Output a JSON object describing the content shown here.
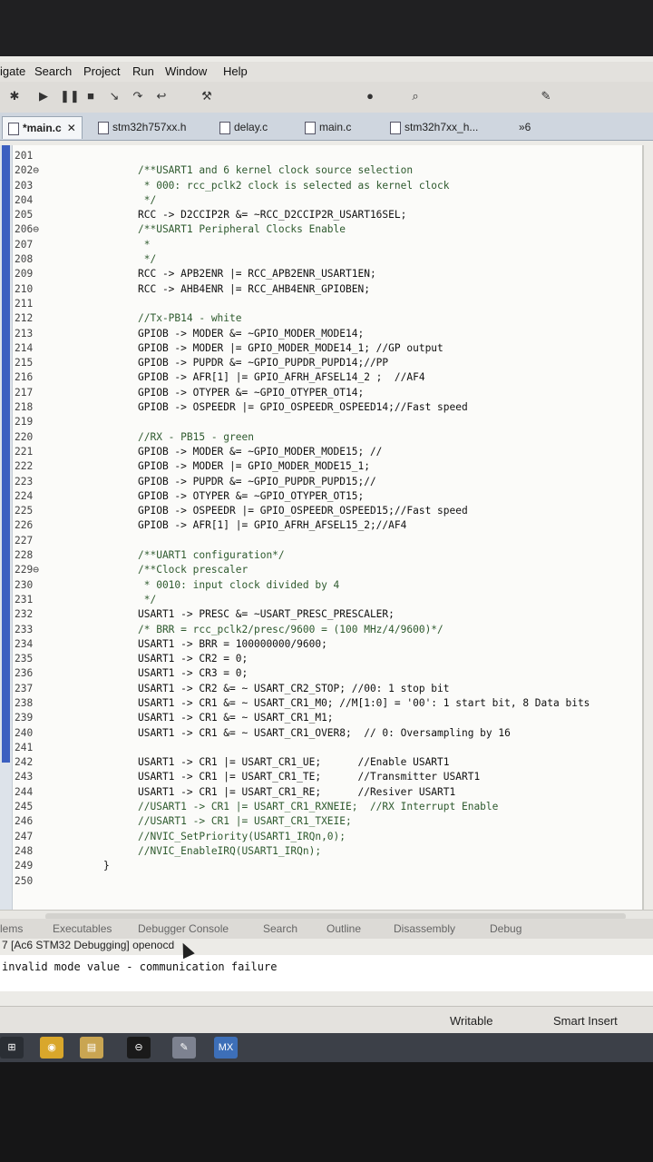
{
  "menu": [
    "igate",
    "Search",
    "Project",
    "Run",
    "Window",
    "Help"
  ],
  "toolbar_icons": [
    "debug-icon",
    "resume-icon",
    "suspend-icon",
    "terminate-icon",
    "step-into-icon",
    "step-over-icon",
    "step-return-icon",
    "build-icon",
    "run-icon",
    "search-icon",
    "pin-icon"
  ],
  "tabs": [
    {
      "label": "*main.c",
      "active": true
    },
    {
      "label": "stm32h757xx.h",
      "active": false
    },
    {
      "label": "delay.c",
      "active": false
    },
    {
      "label": "main.c",
      "active": false
    },
    {
      "label": "stm32h7xx_h...",
      "active": false
    },
    {
      "label": "»6",
      "active": false
    }
  ],
  "code_lines": [
    {
      "n": "201",
      "t": ""
    },
    {
      "n": "202⊖",
      "t": "/**USART1 and 6 kernel clock source selection"
    },
    {
      "n": "203",
      "t": " * 000: rcc_pclk2 clock is selected as kernel clock"
    },
    {
      "n": "204",
      "t": " */"
    },
    {
      "n": "205",
      "t": "RCC -> D2CCIP2R &= ~RCC_D2CCIP2R_USART16SEL;"
    },
    {
      "n": "206⊖",
      "t": "/**USART1 Peripheral Clocks Enable"
    },
    {
      "n": "207",
      "t": " *"
    },
    {
      "n": "208",
      "t": " */"
    },
    {
      "n": "209",
      "t": "RCC -> APB2ENR |= RCC_APB2ENR_USART1EN;"
    },
    {
      "n": "210",
      "t": "RCC -> AHB4ENR |= RCC_AHB4ENR_GPIOBEN;"
    },
    {
      "n": "211",
      "t": ""
    },
    {
      "n": "212",
      "t": "//Tx-PB14 - white"
    },
    {
      "n": "213",
      "t": "GPIOB -> MODER &= ~GPIO_MODER_MODE14;"
    },
    {
      "n": "214",
      "t": "GPIOB -> MODER |= GPIO_MODER_MODE14_1; //GP output"
    },
    {
      "n": "215",
      "t": "GPIOB -> PUPDR &= ~GPIO_PUPDR_PUPD14;//PP"
    },
    {
      "n": "216",
      "t": "GPIOB -> AFR[1] |= GPIO_AFRH_AFSEL14_2 ;  //AF4"
    },
    {
      "n": "217",
      "t": "GPIOB -> OTYPER &= ~GPIO_OTYPER_OT14;"
    },
    {
      "n": "218",
      "t": "GPIOB -> OSPEEDR |= GPIO_OSPEEDR_OSPEED14;//Fast speed"
    },
    {
      "n": "219",
      "t": ""
    },
    {
      "n": "220",
      "t": "//RX - PB15 - green"
    },
    {
      "n": "221",
      "t": "GPIOB -> MODER &= ~GPIO_MODER_MODE15; //"
    },
    {
      "n": "222",
      "t": "GPIOB -> MODER |= GPIO_MODER_MODE15_1;"
    },
    {
      "n": "223",
      "t": "GPIOB -> PUPDR &= ~GPIO_PUPDR_PUPD15;//"
    },
    {
      "n": "224",
      "t": "GPIOB -> OTYPER &= ~GPIO_OTYPER_OT15;"
    },
    {
      "n": "225",
      "t": "GPIOB -> OSPEEDR |= GPIO_OSPEEDR_OSPEED15;//Fast speed"
    },
    {
      "n": "226",
      "t": "GPIOB -> AFR[1] |= GPIO_AFRH_AFSEL15_2;//AF4"
    },
    {
      "n": "227",
      "t": ""
    },
    {
      "n": "228",
      "t": "/**UART1 configuration*/"
    },
    {
      "n": "229⊖",
      "t": "/**Clock prescaler"
    },
    {
      "n": "230",
      "t": " * 0010: input clock divided by 4"
    },
    {
      "n": "231",
      "t": " */"
    },
    {
      "n": "232",
      "t": "USART1 -> PRESC &= ~USART_PRESC_PRESCALER;"
    },
    {
      "n": "233",
      "t": "/* BRR = rcc_pclk2/presc/9600 = (100 MHz/4/9600)*/"
    },
    {
      "n": "234",
      "t": "USART1 -> BRR = 100000000/9600;"
    },
    {
      "n": "235",
      "t": "USART1 -> CR2 = 0;"
    },
    {
      "n": "236",
      "t": "USART1 -> CR3 = 0;"
    },
    {
      "n": "237",
      "t": "USART1 -> CR2 &= ~ USART_CR2_STOP; //00: 1 stop bit"
    },
    {
      "n": "238",
      "t": "USART1 -> CR1 &= ~ USART_CR1_M0; //M[1:0] = '00': 1 start bit, 8 Data bits"
    },
    {
      "n": "239",
      "t": "USART1 -> CR1 &= ~ USART_CR1_M1;"
    },
    {
      "n": "240",
      "t": "USART1 -> CR1 &= ~ USART_CR1_OVER8;  // 0: Oversampling by 16"
    },
    {
      "n": "241",
      "t": ""
    },
    {
      "n": "242",
      "t": "USART1 -> CR1 |= USART_CR1_UE;      //Enable USART1"
    },
    {
      "n": "243",
      "t": "USART1 -> CR1 |= USART_CR1_TE;      //Transmitter USART1"
    },
    {
      "n": "244",
      "t": "USART1 -> CR1 |= USART_CR1_RE;      //Resiver USART1"
    },
    {
      "n": "245",
      "t": "//USART1 -> CR1 |= USART_CR1_RXNEIE;  //RX Interrupt Enable"
    },
    {
      "n": "246",
      "t": "//USART1 -> CR1 |= USART_CR1_TXEIE;"
    },
    {
      "n": "247",
      "t": "//NVIC_SetPriority(USART1_IRQn,0);"
    },
    {
      "n": "248",
      "t": "//NVIC_EnableIRQ(USART1_IRQn);"
    },
    {
      "n": "249",
      "t": "}"
    },
    {
      "n": "250",
      "t": ""
    }
  ],
  "bottom_tabs": [
    "lems",
    "Executables",
    "Debugger Console",
    "Search",
    "Outline",
    "Disassembly",
    "Debug"
  ],
  "console": {
    "title": "7 [Ac6 STM32 Debugging] openocd",
    "message": "invalid mode value - communication failure"
  },
  "status": {
    "writable": "Writable",
    "insert_mode": "Smart Insert"
  },
  "taskbar_items": [
    "windows-start-icon",
    "chrome-icon",
    "file-explorer-icon",
    "media-icon",
    "settings-icon",
    "stm32cubemx-icon"
  ],
  "taskbar_labels": {
    "stm32cubemx-icon": "MX"
  }
}
